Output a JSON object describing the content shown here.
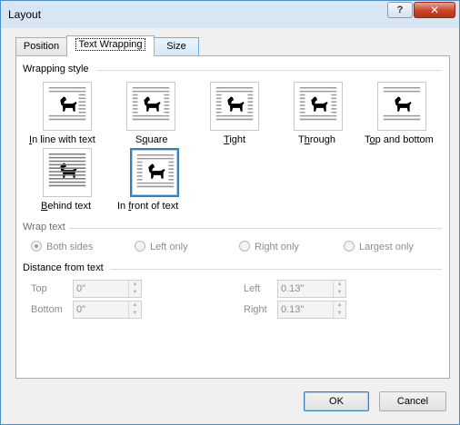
{
  "window": {
    "title": "Layout",
    "help_label": "?",
    "close_label": "✕"
  },
  "tabs": [
    {
      "label": "Position"
    },
    {
      "label": "Text Wrapping"
    },
    {
      "label": "Size"
    }
  ],
  "wrapping_style": {
    "heading": "Wrapping style",
    "options": [
      {
        "label": "In line with text",
        "icon": "wrap-inline-icon",
        "accel": "I"
      },
      {
        "label": "Square",
        "icon": "wrap-square-icon",
        "accel": "q"
      },
      {
        "label": "Tight",
        "icon": "wrap-tight-icon",
        "accel": "T"
      },
      {
        "label": "Through",
        "icon": "wrap-through-icon",
        "accel": "h"
      },
      {
        "label": "Top and bottom",
        "icon": "wrap-top-bottom-icon",
        "accel": "o"
      },
      {
        "label": "Behind text",
        "icon": "wrap-behind-icon",
        "accel": "B"
      },
      {
        "label": "In front of text",
        "icon": "wrap-front-icon",
        "accel": "f"
      }
    ],
    "selected": "In front of text"
  },
  "wrap_text": {
    "heading": "Wrap text",
    "options": [
      "Both sides",
      "Left only",
      "Right only",
      "Largest only"
    ],
    "selected": "Both sides",
    "enabled": false
  },
  "distance": {
    "heading": "Distance from text",
    "top_label": "Top",
    "top_value": "0\"",
    "bottom_label": "Bottom",
    "bottom_value": "0\"",
    "left_label": "Left",
    "left_value": "0.13\"",
    "right_label": "Right",
    "right_value": "0.13\""
  },
  "buttons": {
    "ok": "OK",
    "cancel": "Cancel"
  },
  "colors": {
    "selection_border": "#3c7fb1",
    "window_border": "#4a8ec9"
  }
}
